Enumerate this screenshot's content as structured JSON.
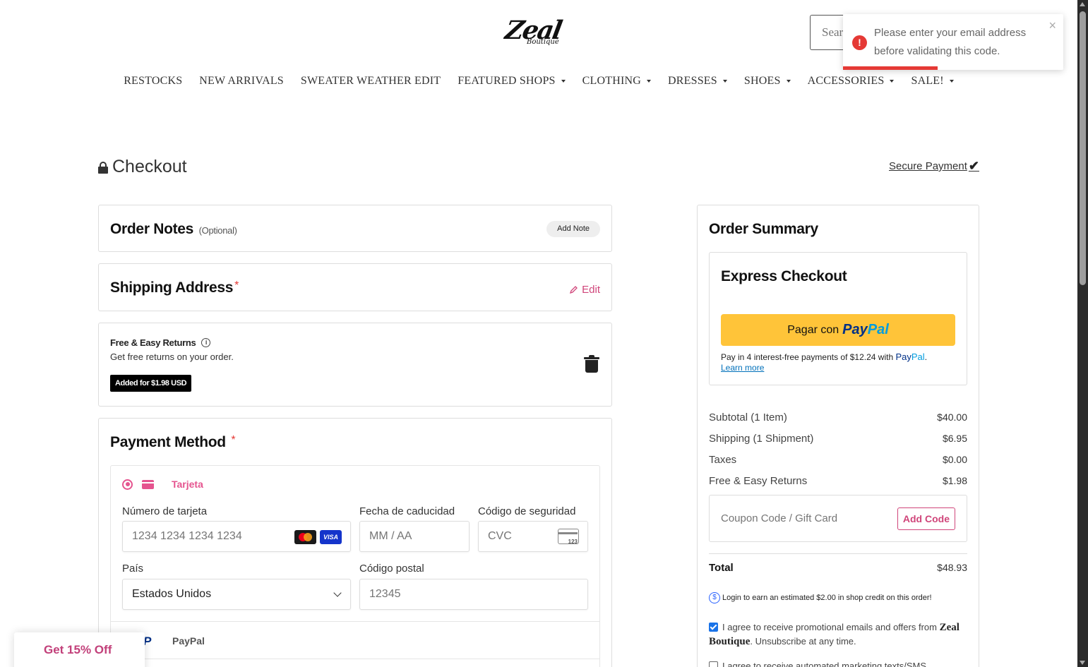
{
  "header": {
    "logo_text": "Zeal",
    "logo_sub": "Boutique",
    "search_placeholder": "Search"
  },
  "toast": {
    "message": "Please enter your email address before validating this code.",
    "close": "×",
    "icon": "error-icon",
    "progress_fraction": 0.43
  },
  "nav": {
    "items": [
      {
        "label": "RESTOCKS",
        "dropdown": false
      },
      {
        "label": "NEW ARRIVALS",
        "dropdown": false
      },
      {
        "label": "SWEATER WEATHER EDIT",
        "dropdown": false
      },
      {
        "label": "FEATURED SHOPS",
        "dropdown": true
      },
      {
        "label": "CLOTHING",
        "dropdown": true
      },
      {
        "label": "DRESSES",
        "dropdown": true
      },
      {
        "label": "SHOES",
        "dropdown": true
      },
      {
        "label": "ACCESSORIES",
        "dropdown": true
      },
      {
        "label": "SALE!",
        "dropdown": true
      }
    ]
  },
  "checkout": {
    "title": "Checkout",
    "secure_payment": "Secure Payment",
    "check": "✔"
  },
  "notes": {
    "title": "Order Notes",
    "optional": "(Optional)",
    "add_note": "Add Note"
  },
  "shipping": {
    "title": "Shipping Address",
    "required": "*",
    "edit": "Edit"
  },
  "returns": {
    "title": "Free & Easy Returns",
    "info": "i",
    "desc": "Get free returns on your order.",
    "badge": "Added for $1.98 USD"
  },
  "payment": {
    "title": "Payment Method",
    "required": "*",
    "option_card": "Tarjeta",
    "card_number_label": "Número de tarjeta",
    "card_number_placeholder": "1234 1234 1234 1234",
    "expiry_label": "Fecha de caducidad",
    "expiry_placeholder": "MM / AA",
    "cvc_label": "Código de seguridad",
    "cvc_placeholder": "CVC",
    "cvc_icon_text": "123",
    "visa": "VISA",
    "country_label": "País",
    "country_value": "Estados Unidos",
    "postal_label": "Código postal",
    "postal_placeholder": "12345",
    "option_paypal": "PayPal",
    "paypal_icon": "P"
  },
  "promo": {
    "label": "Get 15% Off"
  },
  "summary": {
    "title": "Order Summary",
    "express_title": "Express Checkout",
    "paypal_btn_prefix": "Pagar con",
    "paypal_pay": "Pay",
    "paypal_pal": "Pal",
    "pay_later": "Pay in 4 interest-free payments of $12.24 with",
    "learn_more": "Learn more",
    "rows": [
      {
        "label": "Subtotal (1 Item)",
        "value": "$40.00"
      },
      {
        "label": "Shipping (1 Shipment)",
        "value": "$6.95"
      },
      {
        "label": "Taxes",
        "value": "$0.00"
      },
      {
        "label": "Free & Easy Returns",
        "value": "$1.98"
      }
    ],
    "coupon_placeholder": "Coupon Code / Gift Card",
    "add_code": "Add Code",
    "total_label": "Total",
    "total_value": "$48.93",
    "credit_icon": "$",
    "credit_text": "Login to earn an estimated $2.00 in shop credit on this order!",
    "agree_pre": "I agree to receive promotional emails and offers from",
    "agree_brand": "Zeal Boutique",
    "agree_post": ". Unsubscribe at any time.",
    "agree_sms": "I agree to receive automated marketing texts/SMS"
  }
}
